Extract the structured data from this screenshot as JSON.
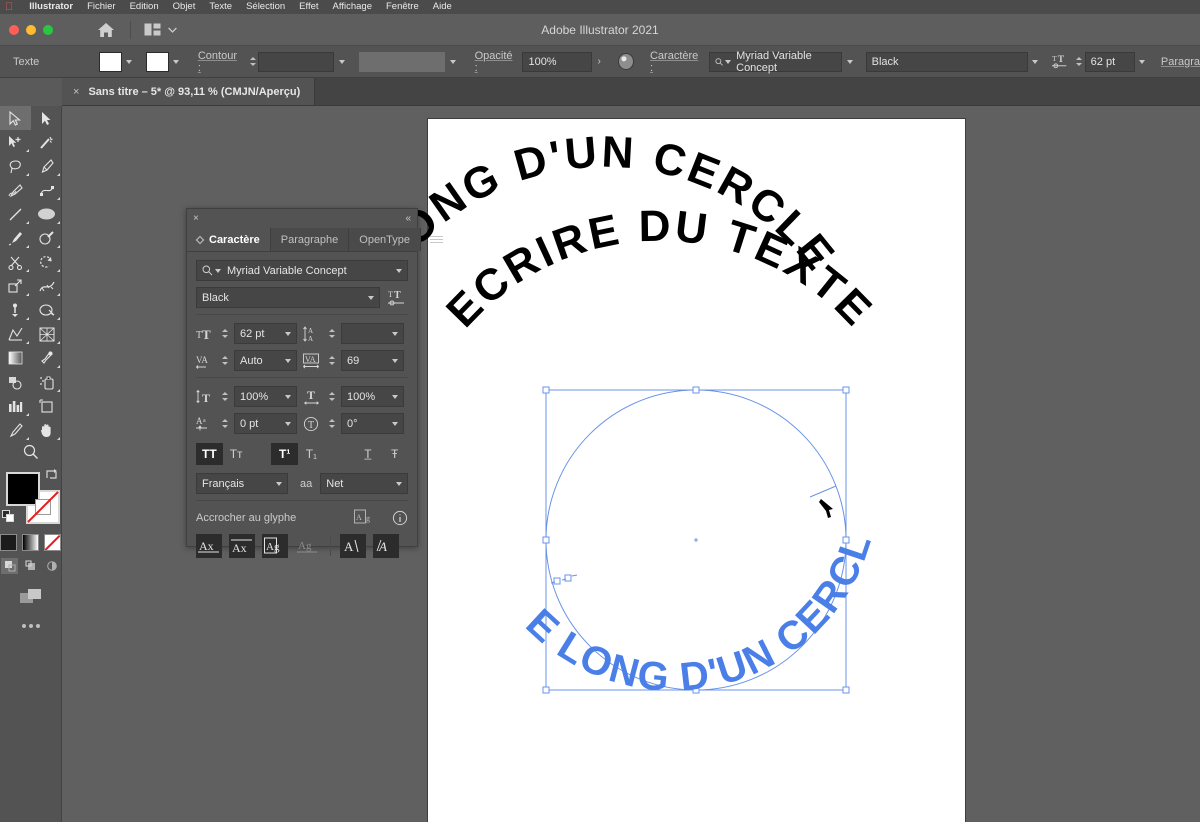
{
  "menubar": {
    "apple": "",
    "items": [
      "Illustrator",
      "Fichier",
      "Edition",
      "Objet",
      "Texte",
      "Sélection",
      "Effet",
      "Affichage",
      "Fenêtre",
      "Aide"
    ]
  },
  "titlebar": {
    "app_title": "Adobe Illustrator 2021"
  },
  "controlbar": {
    "tool_label": "Texte",
    "fill_color": "#000000",
    "stroke_label": "Contour :",
    "stroke_weight": "",
    "stroke_profile": "",
    "opacity_label": "Opacité :",
    "opacity_value": "100%",
    "character_label": "Caractère :",
    "font_family": "Myriad Variable Concept",
    "font_style": "Black",
    "font_size": "62 pt",
    "paragraph_label": "Paragra"
  },
  "document_tab": {
    "close": "×",
    "title": "Sans titre – 5* @ 93,11 % (CMJN/Aperçu)"
  },
  "tools": {
    "items": [
      {
        "name": "selection-tool",
        "glyph": "selection",
        "selected": true
      },
      {
        "name": "direct-selection-tool",
        "glyph": "direct-selection",
        "selected": false
      },
      {
        "name": "magic-wand-tool",
        "glyph": "group-selection",
        "selected": false
      },
      {
        "name": "lasso-tool",
        "glyph": "magic-wand",
        "selected": false
      },
      {
        "name": "pen-tool",
        "glyph": "pen",
        "selected": false
      },
      {
        "name": "curvature-tool",
        "glyph": "curvature",
        "selected": false
      },
      {
        "name": "type-tool",
        "glyph": "type",
        "selected": false
      },
      {
        "name": "line-segment-tool",
        "glyph": "line",
        "selected": false
      },
      {
        "name": "rectangle-tool",
        "glyph": "rect",
        "selected": false
      },
      {
        "name": "ellipse-tool",
        "glyph": "ellipse",
        "selected": false
      },
      {
        "name": "paintbrush-tool",
        "glyph": "brush",
        "selected": false
      },
      {
        "name": "shaper-tool",
        "glyph": "shaper",
        "selected": false
      },
      {
        "name": "pencil-tool",
        "glyph": "pencil",
        "selected": false
      },
      {
        "name": "eraser-tool",
        "glyph": "eraser",
        "selected": false
      },
      {
        "name": "rotate-tool",
        "glyph": "rotate",
        "selected": false
      },
      {
        "name": "scale-tool",
        "glyph": "scale",
        "selected": false
      },
      {
        "name": "width-tool",
        "glyph": "width",
        "selected": false
      },
      {
        "name": "free-transform-tool",
        "glyph": "free-transform",
        "selected": false
      },
      {
        "name": "puppet-warp-tool",
        "glyph": "puppet",
        "selected": false
      },
      {
        "name": "shape-builder-tool",
        "glyph": "shape-builder",
        "selected": false
      },
      {
        "name": "perspective-grid-tool",
        "glyph": "perspective",
        "selected": false
      },
      {
        "name": "mesh-tool",
        "glyph": "mesh",
        "selected": false
      },
      {
        "name": "gradient-tool",
        "glyph": "gradient",
        "selected": false
      },
      {
        "name": "eyedropper-tool",
        "glyph": "eyedropper",
        "selected": false
      },
      {
        "name": "blend-tool",
        "glyph": "blend",
        "selected": false
      },
      {
        "name": "symbol-sprayer-tool",
        "glyph": "symbol-sprayer",
        "selected": false
      },
      {
        "name": "column-graph-tool",
        "glyph": "graph",
        "selected": false
      },
      {
        "name": "artboard-tool",
        "glyph": "artboard",
        "selected": false
      },
      {
        "name": "slice-tool",
        "glyph": "slice",
        "selected": false
      },
      {
        "name": "hand-tool",
        "glyph": "hand",
        "selected": false
      },
      {
        "name": "zoom-tool",
        "glyph": "zoom",
        "selected": false
      }
    ],
    "fill_color": "#000000",
    "stroke_color": "#ffffff",
    "color_modes": [
      "color",
      "gradient",
      "none"
    ],
    "draw_modes": [
      "draw-normal",
      "draw-behind",
      "draw-inside"
    ],
    "screen_mode": "change-screen-mode",
    "more_tools": "•••"
  },
  "character_panel": {
    "close": "×",
    "collapse": "«",
    "tabs": [
      {
        "label": "Caractère",
        "active": true
      },
      {
        "label": "Paragraphe",
        "active": false
      },
      {
        "label": "OpenType",
        "active": false
      }
    ],
    "menu_icon": "hamburger-icon",
    "font_family": "Myriad Variable Concept",
    "font_style": "Black",
    "font_size": "62 pt",
    "leading": "",
    "kerning": "Auto",
    "tracking": "69",
    "vertical_scale": "100%",
    "horizontal_scale": "100%",
    "baseline_shift": "0 pt",
    "character_rotation": "0°",
    "style_buttons": [
      {
        "name": "all-caps-button",
        "label": "TT",
        "active": true
      },
      {
        "name": "small-caps-button",
        "label": "Tᴛ",
        "active": false
      },
      {
        "name": "superscript-button",
        "label": "T¹",
        "active": true
      },
      {
        "name": "subscript-button",
        "label": "T₁",
        "active": false
      },
      {
        "name": "underline-button",
        "label": "T̲",
        "active": false
      },
      {
        "name": "strikethrough-button",
        "label": "Ŧ",
        "active": false
      }
    ],
    "language": "Français",
    "anti_alias_label": "aa",
    "anti_alias": "Net",
    "snap_to_glyph_label": "Accrocher au glyphe",
    "glyph_icons": [
      "glyph-box-icon",
      "info-icon"
    ],
    "glyph_buttons": [
      {
        "name": "snap-baseline-button",
        "label": "Ax",
        "active": true
      },
      {
        "name": "snap-xheight-button",
        "label": "Ax̄",
        "active": true
      },
      {
        "name": "snap-em-box-button",
        "label": "Ag",
        "active": true
      },
      {
        "name": "snap-descender-button",
        "label": "Ag",
        "active": false
      },
      {
        "name": "snap-stem-button",
        "label": "A",
        "active": true
      },
      {
        "name": "snap-italic-button",
        "label": "A",
        "active": true
      }
    ]
  },
  "artwork": {
    "outer_text": "ECRIRE DU TEXTE",
    "middle_text": "LE LONG D'UN CERCLE",
    "inner_text": "LE LONG D'UN CERCLE",
    "outer_color": "#000000",
    "middle_color": "#000000",
    "inner_color": "#4a7fe8",
    "selection_color": "#6a93e8",
    "cursor": "arrow-cursor"
  }
}
